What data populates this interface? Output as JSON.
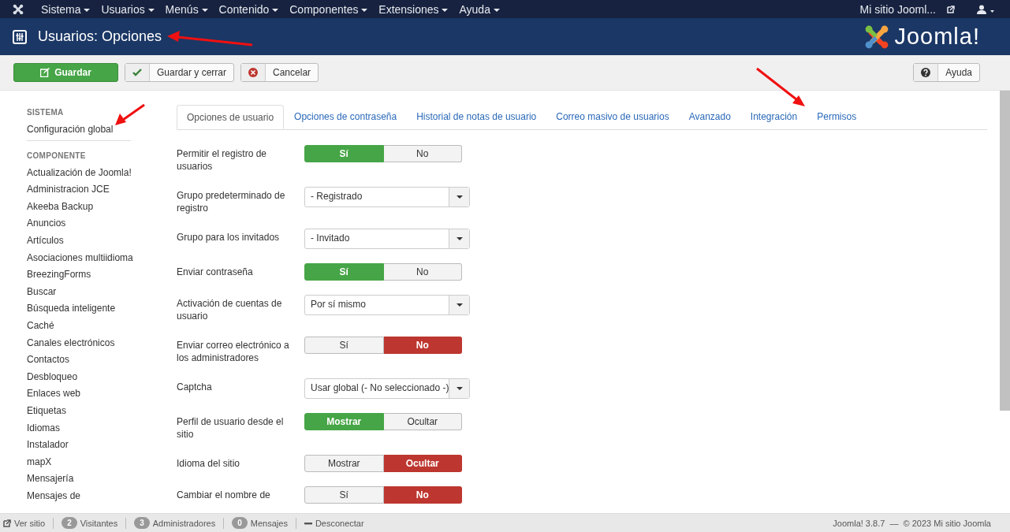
{
  "topbar": {
    "menus": [
      "Sistema",
      "Usuarios",
      "Menús",
      "Contenido",
      "Componentes",
      "Extensiones",
      "Ayuda"
    ],
    "site_link": "Mi sitio Jooml..."
  },
  "header": {
    "title": "Usuarios: Opciones",
    "logo_text": "Joomla!"
  },
  "toolbar": {
    "buttons": [
      {
        "label": "Guardar",
        "kind": "save"
      },
      {
        "label": "Guardar y cerrar",
        "kind": "check"
      },
      {
        "label": "Cancelar",
        "kind": "cancel"
      }
    ],
    "help": "Ayuda"
  },
  "sidebar": {
    "sections": [
      {
        "heading": "SISTEMA",
        "items": [
          "Configuración global"
        ]
      },
      {
        "heading": "COMPONENTE",
        "items": [
          "Actualización de Joomla!",
          "Administracion JCE",
          "Akeeba Backup",
          "Anuncios",
          "Artículos",
          "Asociaciones multiidioma",
          "BreezingForms",
          "Buscar",
          "Búsqueda inteligente",
          "Caché",
          "Canales electrónicos",
          "Contactos",
          "Desbloqueo",
          "Enlaces web",
          "Etiquetas",
          "Idiomas",
          "Instalador",
          "mapX",
          "Mensajería",
          "Mensajes de"
        ]
      }
    ]
  },
  "tabs": [
    {
      "label": "Opciones de usuario",
      "selected": true
    },
    {
      "label": "Opciones de contraseña",
      "selected": false
    },
    {
      "label": "Historial de notas de usuario",
      "selected": false
    },
    {
      "label": "Correo masivo de usuarios",
      "selected": false
    },
    {
      "label": "Avanzado",
      "selected": false
    },
    {
      "label": "Integración",
      "selected": false
    },
    {
      "label": "Permisos",
      "selected": false
    }
  ],
  "fields": [
    {
      "label": "Permitir el registro de usuarios",
      "kind": "toggle",
      "options": [
        {
          "label": "Sí",
          "selected": true
        },
        {
          "label": "No",
          "selected": false
        }
      ]
    },
    {
      "label": "Grupo predeterminado de registro",
      "kind": "select",
      "value": "- Registrado"
    },
    {
      "label": "Grupo para los invitados",
      "kind": "select",
      "value": "- Invitado"
    },
    {
      "label": "Enviar contraseña",
      "kind": "toggle",
      "options": [
        {
          "label": "Sí",
          "selected": true
        },
        {
          "label": "No",
          "selected": false
        }
      ]
    },
    {
      "label": "Activación de cuentas de usuario",
      "kind": "select",
      "value": "Por sí mismo"
    },
    {
      "label": "Enviar correo electrónico a los administradores",
      "kind": "toggle",
      "options": [
        {
          "label": "Sí",
          "selected": false
        },
        {
          "label": "No",
          "selected": true
        }
      ]
    },
    {
      "label": "Captcha",
      "kind": "select",
      "value": "Usar global (- No seleccionado -)"
    },
    {
      "label": "Perfil de usuario desde el sitio",
      "kind": "toggle",
      "options": [
        {
          "label": "Mostrar",
          "selected": true
        },
        {
          "label": "Ocultar",
          "selected": false
        }
      ]
    },
    {
      "label": "Idioma del sitio",
      "kind": "toggle",
      "options": [
        {
          "label": "Mostrar",
          "selected": false
        },
        {
          "label": "Ocultar",
          "selected": true
        }
      ]
    },
    {
      "label": "Cambiar el nombre de",
      "kind": "toggle",
      "options": [
        {
          "label": "Sí",
          "selected": false
        },
        {
          "label": "No",
          "selected": true
        }
      ]
    }
  ],
  "status_bar": {
    "items": [
      {
        "kind": "link",
        "label": "Ver sitio"
      },
      {
        "kind": "badge",
        "count": "2",
        "label": "Visitantes"
      },
      {
        "kind": "badge",
        "count": "3",
        "label": "Administradores"
      },
      {
        "kind": "badge",
        "count": "0",
        "label": "Mensajes"
      },
      {
        "kind": "logout",
        "label": "Desconectar"
      }
    ],
    "copyright": "Joomla! 3.8.7  —  © 2023 Mi sitio Joomla"
  }
}
